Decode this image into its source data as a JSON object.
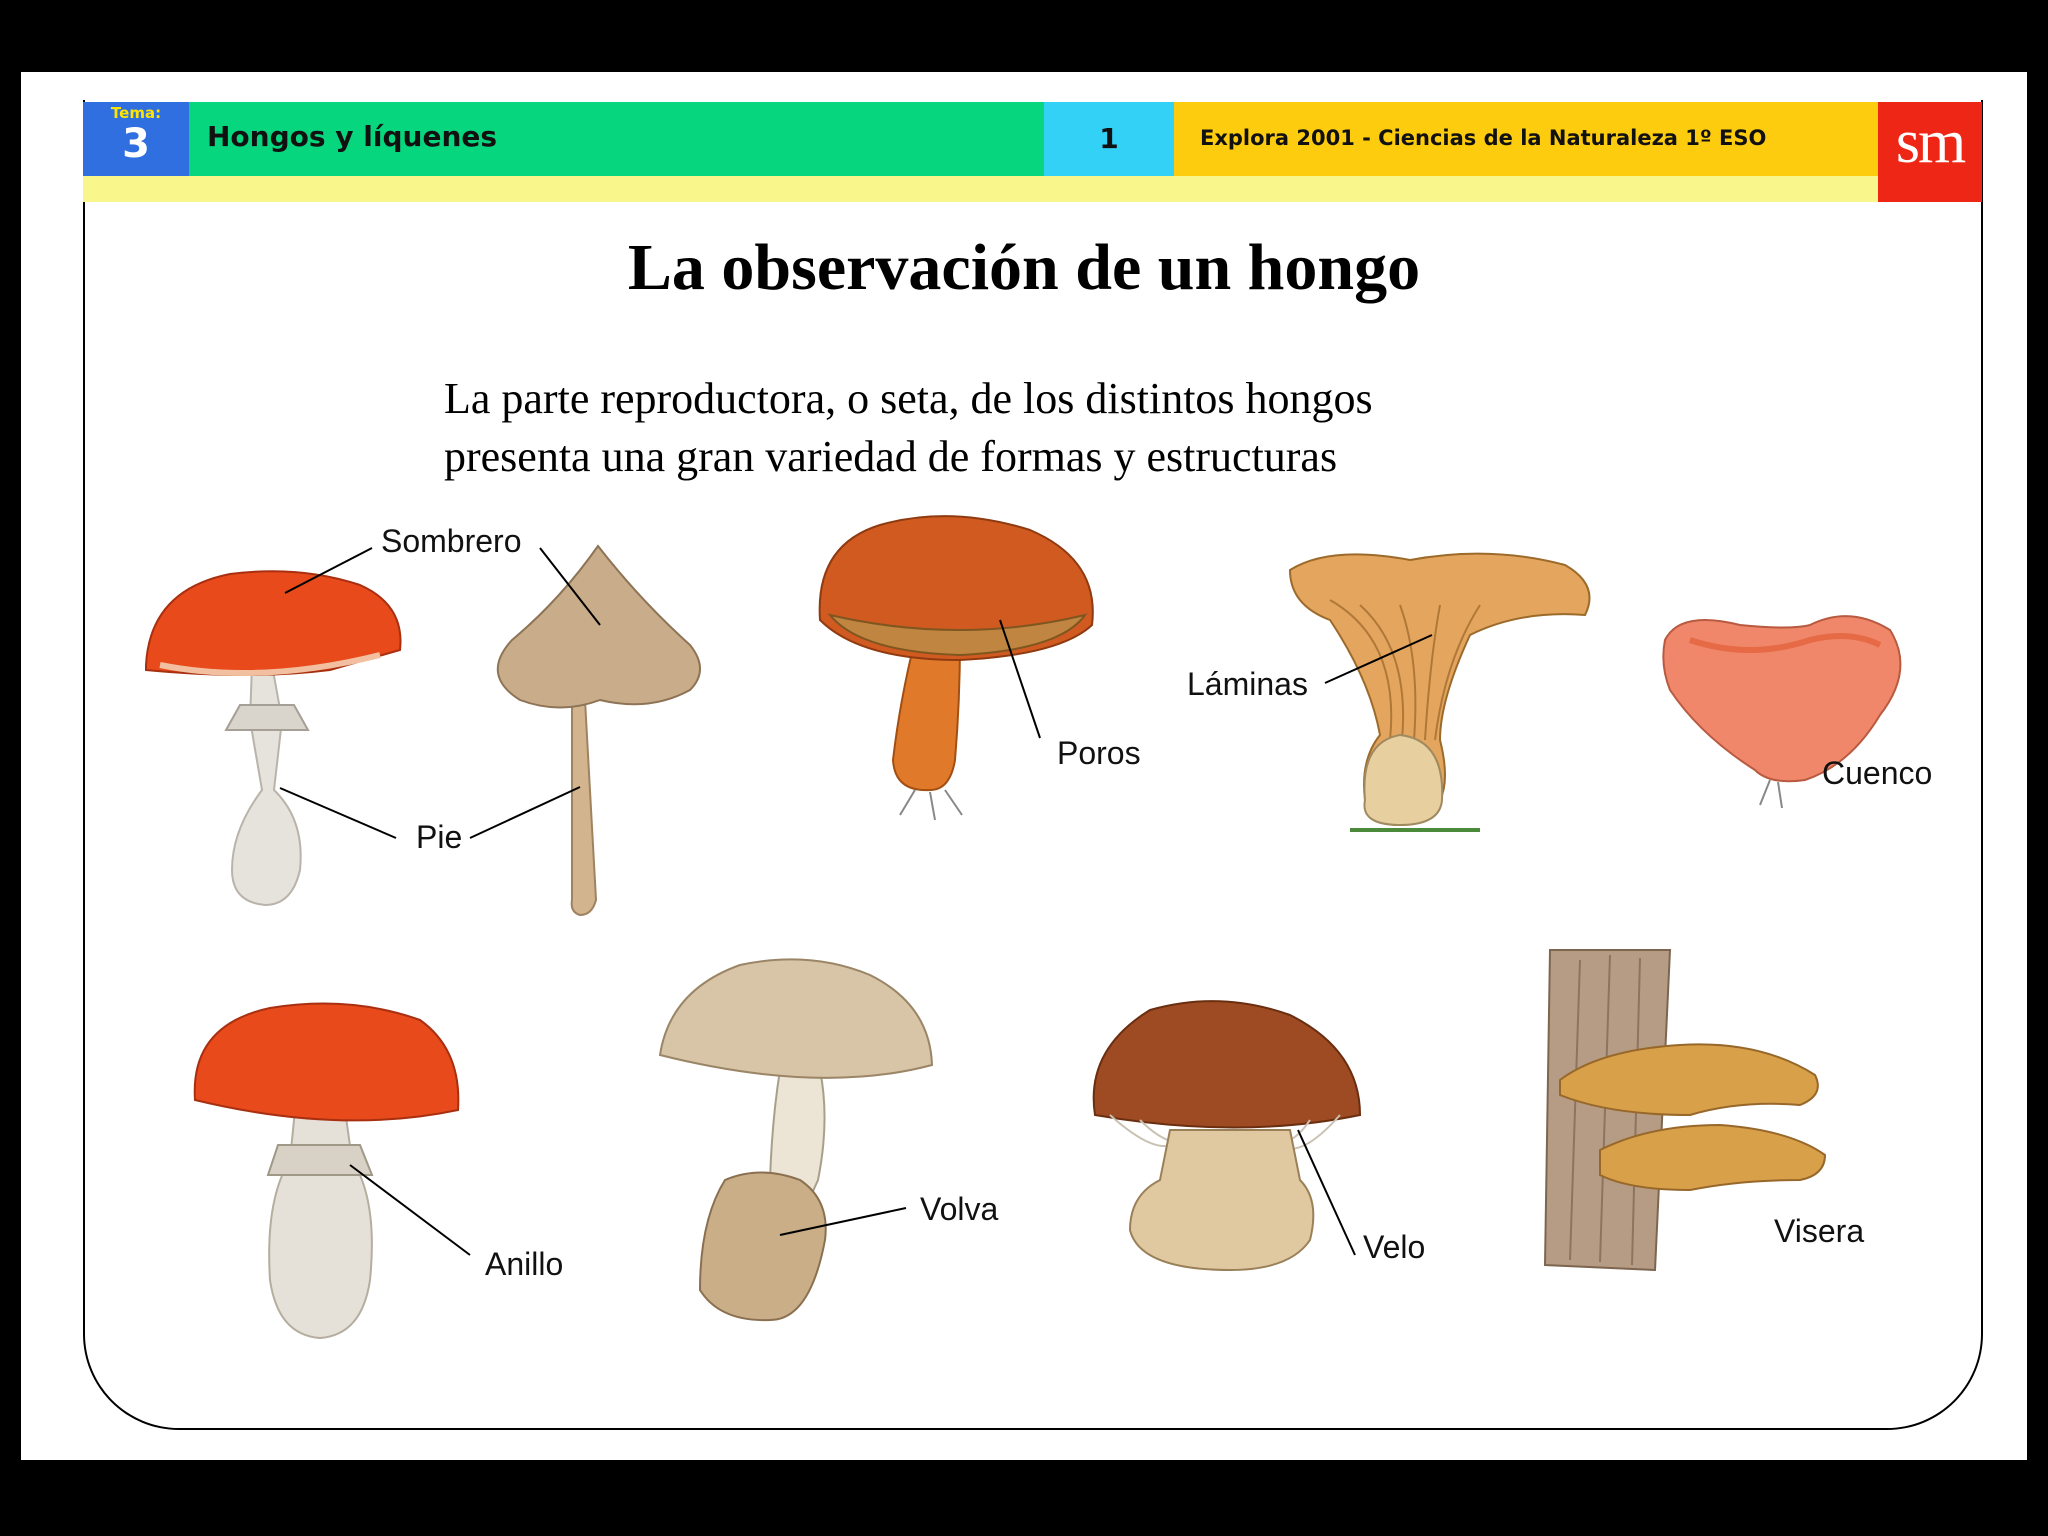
{
  "header": {
    "tema_label": "Tema:",
    "tema_number": "3",
    "unit_title": "Hongos y líquenes",
    "page_number": "1",
    "course": "Explora 2001 - Ciencias de la Naturaleza 1º ESO",
    "logo": "sm"
  },
  "main": {
    "title": "La observación de un hongo",
    "intro_lines": [
      "La parte reproductora, o seta,  de los distintos hongos",
      "presenta una gran variedad de formas y estructuras"
    ]
  },
  "labels": {
    "sombrero": "Sombrero",
    "pie": "Pie",
    "poros": "Poros",
    "laminas": "Láminas",
    "cuenco": "Cuenco",
    "anillo": "Anillo",
    "volva": "Volva",
    "velo": "Velo",
    "visera": "Visera"
  },
  "colors": {
    "tema_bg": "#2f6fe0",
    "title_bg": "#06d67d",
    "page_bg": "#33d1f5",
    "course_bg": "#fdcc0e",
    "logo_bg": "#ee2616",
    "underbar": "#f9f78c"
  }
}
